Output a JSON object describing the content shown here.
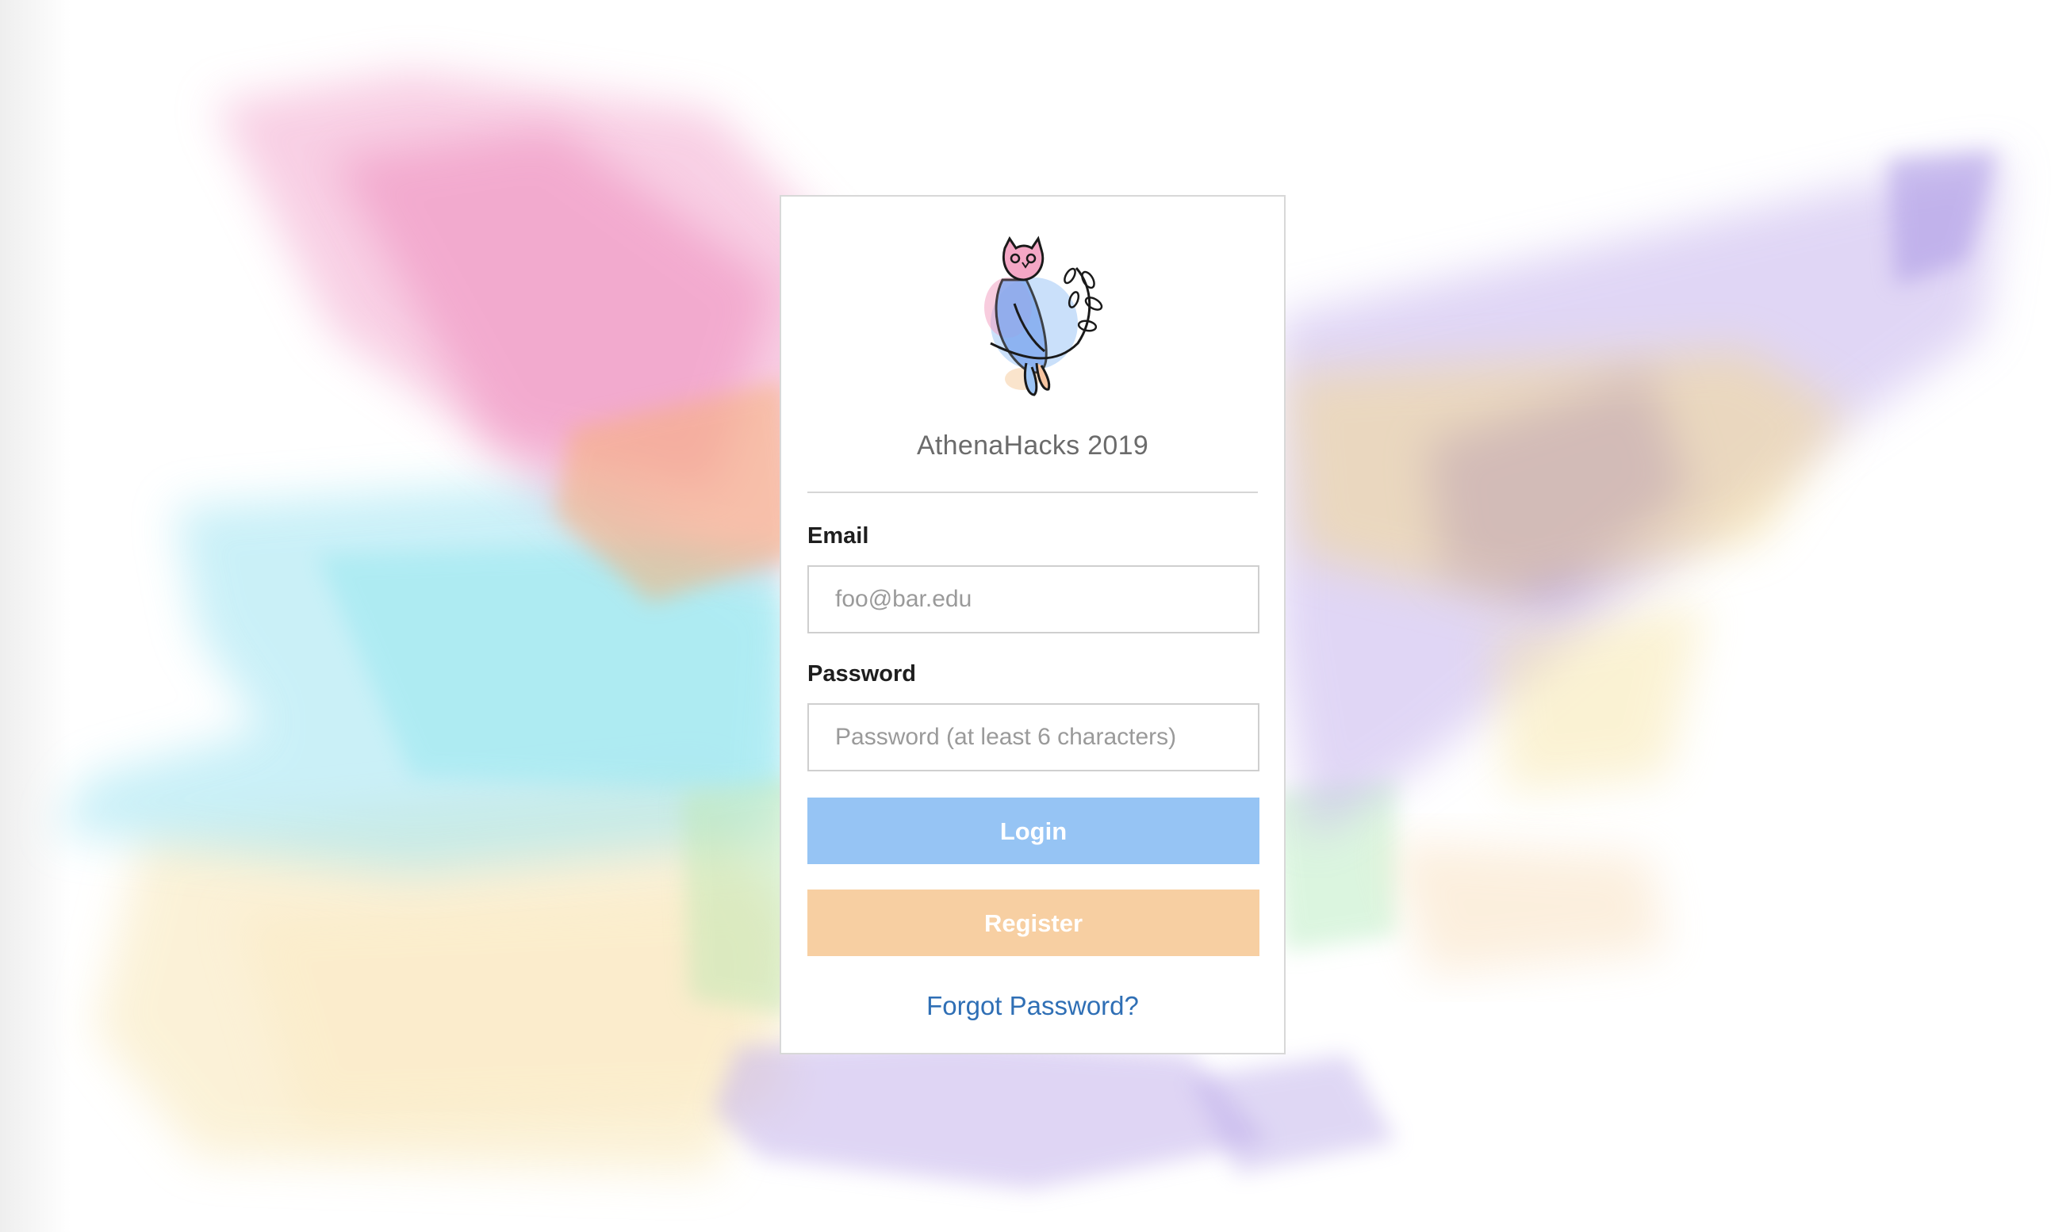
{
  "app": {
    "title": "AthenaHacks 2019"
  },
  "login_form": {
    "email_label": "Email",
    "email_placeholder": "foo@bar.edu",
    "email_value": "",
    "password_label": "Password",
    "password_placeholder": "Password (at least 6 characters)",
    "password_value": "",
    "login_label": "Login",
    "register_label": "Register",
    "forgot_label": "Forgot Password?"
  },
  "icons": {
    "logo": "owl-logo-icon"
  },
  "colors": {
    "login_button": "#96c4f4",
    "register_button": "#f7cfa2",
    "link": "#2f6fb5",
    "title_text": "#6b6b6b"
  }
}
